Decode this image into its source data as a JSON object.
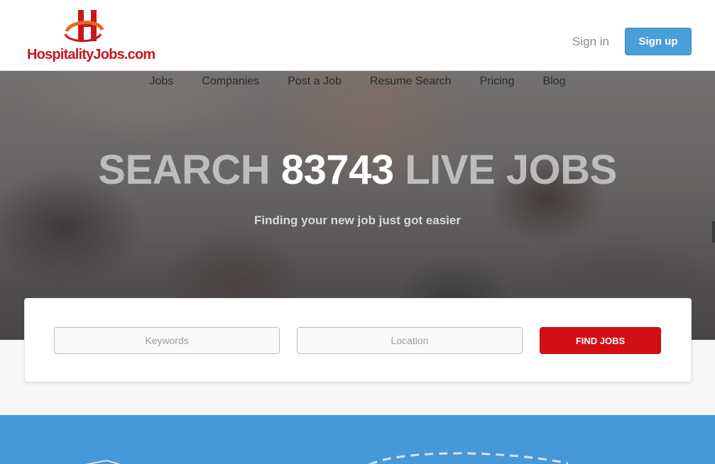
{
  "header": {
    "logo_text": "HospitalityJobs.com",
    "signin_label": "Sign in",
    "signup_label": "Sign up"
  },
  "nav": {
    "items": [
      {
        "label": "Jobs"
      },
      {
        "label": "Companies"
      },
      {
        "label": "Post a Job"
      },
      {
        "label": "Resume Search"
      },
      {
        "label": "Pricing"
      },
      {
        "label": "Blog"
      }
    ]
  },
  "hero": {
    "headline_prefix": "SEARCH",
    "job_count": "83743",
    "headline_suffix": "LIVE JOBS",
    "subtitle": "Finding your new job just got easier"
  },
  "search": {
    "keywords_placeholder": "Keywords",
    "location_placeholder": "Location",
    "find_label": "FIND JOBS"
  },
  "colors": {
    "brand_red": "#c8161d",
    "accent_blue": "#4a9fd9",
    "button_red": "#d10f14",
    "band_blue": "#4599d6"
  }
}
